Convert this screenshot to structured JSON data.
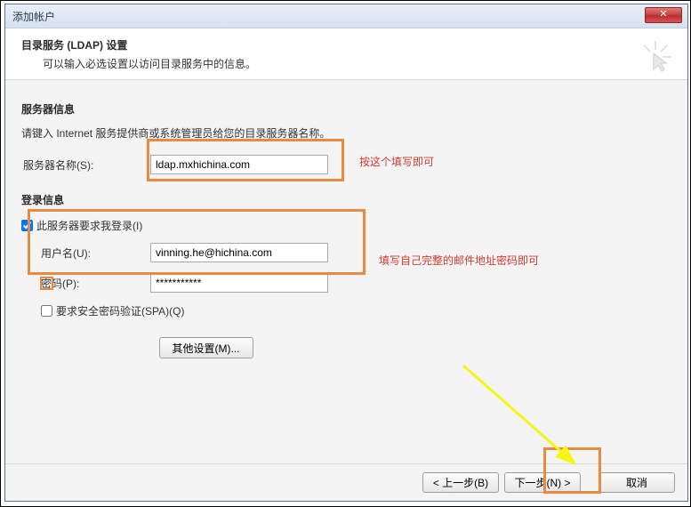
{
  "titlebar": {
    "title": "添加帐户",
    "close_glyph": "✕"
  },
  "header": {
    "title": "目录服务 (LDAP) 设置",
    "subtitle": "可以输入必选设置以访问目录服务中的信息。"
  },
  "server_section": {
    "title": "服务器信息",
    "instruction": "请键入 Internet 服务提供商或系统管理员给您的目录服务器名称。",
    "server_label": "服务器名称(S):",
    "server_value": "ldap.mxhichina.com"
  },
  "login_section": {
    "title": "登录信息",
    "require_login_label": "此服务器要求我登录(I)",
    "require_login_checked": true,
    "username_label": "用户名(U):",
    "username_value": "vinning.he@hichina.com",
    "password_label": "密码(P):",
    "password_value": "***********",
    "spa_label": "要求安全密码验证(SPA)(Q)",
    "spa_checked": false
  },
  "buttons": {
    "more": "其他设置(M)...",
    "back": "< 上一步(B)",
    "next": "下一步(N) >",
    "cancel": "取消"
  },
  "annotations": {
    "hint1": "按这个填写即可",
    "hint2": "填写自己完整的邮件地址密码即可"
  }
}
